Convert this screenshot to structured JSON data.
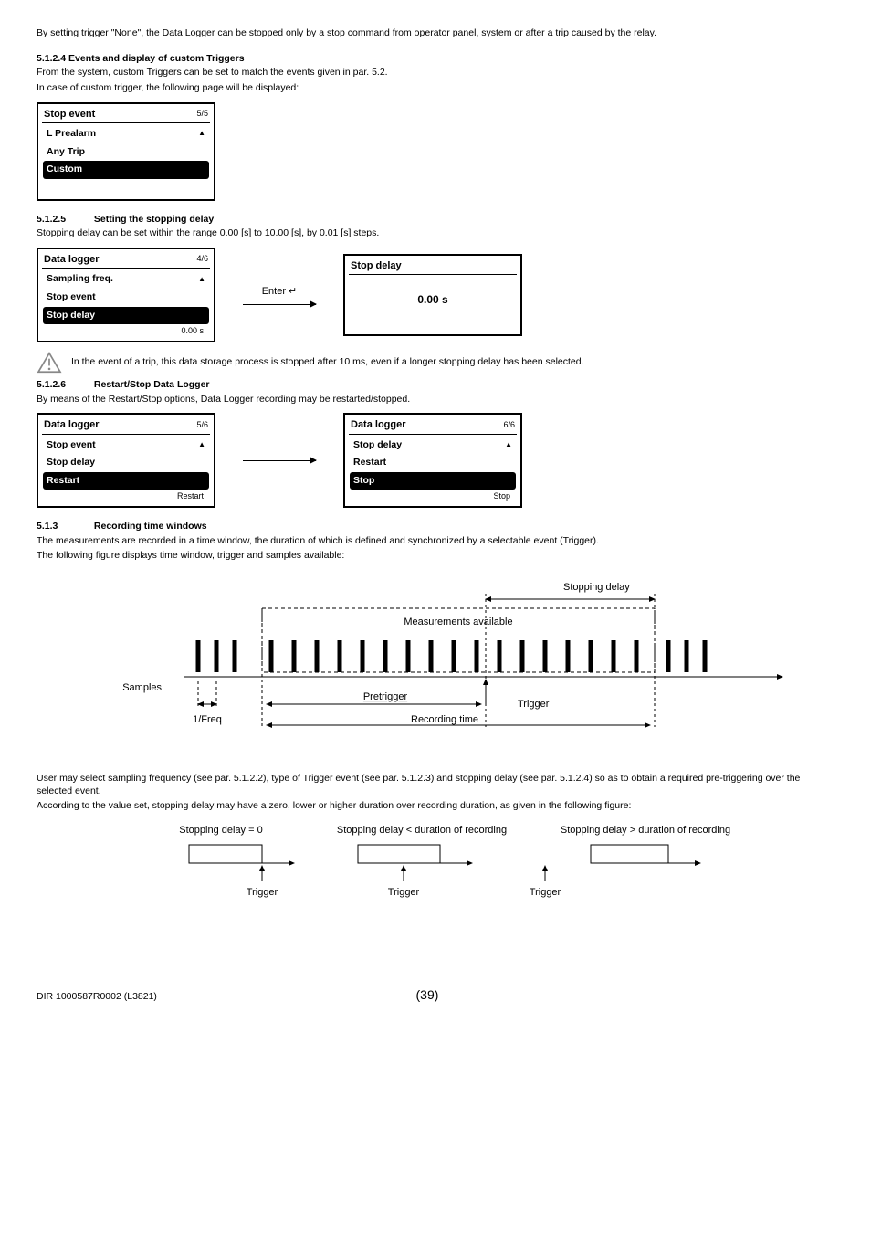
{
  "intro_para": "By setting trigger \"None\", the Data Logger can be stopped only by a stop command from operator panel, system or after a trip caused by the relay.",
  "sec_5124": {
    "heading": "5.1.2.4 Events and display of custom Triggers",
    "l1": "From the system, custom Triggers can be set to match the events given in par. 5.2.",
    "l2": "In case of custom trigger, the following page will be displayed:"
  },
  "panel_stopevent": {
    "title": "Stop event",
    "page": "5/5",
    "items": [
      "L Prealarm",
      "Any Trip",
      "Custom"
    ],
    "selected": "Custom"
  },
  "sec_5125": {
    "num": "5.1.2.5",
    "title": "Setting the stopping delay",
    "l1": "Stopping delay can be set within the range 0.00 [s] to 10.00 [s], by 0.01 [s] steps."
  },
  "panel_datalogger_46": {
    "title": "Data logger",
    "page": "4/6",
    "items": [
      "Sampling freq.",
      "Stop event",
      "Stop delay"
    ],
    "selected": "Stop delay",
    "footer": "0.00 s"
  },
  "enter_label": "Enter ↵",
  "panel_stopdelay_value": {
    "title": "Stop delay",
    "value": "0.00 s"
  },
  "warn_text": "In the event of a trip, this data storage process is stopped after 10 ms, even if a longer stopping delay has been selected.",
  "sec_5126": {
    "num": "5.1.2.6",
    "title": "Restart/Stop Data Logger",
    "l1": "By means of the Restart/Stop options, Data Logger recording may be restarted/stopped."
  },
  "panel_datalogger_56": {
    "title": "Data logger",
    "page": "5/6",
    "items": [
      "Stop event",
      "Stop delay",
      "Restart"
    ],
    "selected": "Restart",
    "footer": "Restart"
  },
  "panel_datalogger_66": {
    "title": "Data logger",
    "page": "6/6",
    "items": [
      "Stop delay",
      "Restart",
      "Stop"
    ],
    "selected": "Stop",
    "footer": "Stop"
  },
  "sec_513": {
    "num": "5.1.3",
    "title": "Recording time windows",
    "l1": "The measurements are recorded in a time window, the duration of which is defined and synchronized by a selectable event (Trigger).",
    "l2": "The following figure displays time window, trigger and samples available:"
  },
  "fig1_labels": {
    "stopping_delay": "Stopping delay",
    "measurements": "Measurements available",
    "samples": "Samples",
    "pretrigger": "Pretrigger",
    "trigger": "Trigger",
    "one_over_freq": "1/Freq",
    "recording_time": "Recording time"
  },
  "after_fig1": {
    "l1": "User may select sampling frequency (see par. 5.1.2.2), type of Trigger event (see par. 5.1.2.3) and stopping delay (see par. 5.1.2.4) so as to obtain a required pre-triggering over the selected event.",
    "l2": "According to the value set, stopping delay may have a zero, lower or higher duration over recording duration, as given in the following figure:"
  },
  "fig2_labels": {
    "c1": "Stopping delay = 0",
    "c2": "Stopping delay < duration of recording",
    "c3": "Stopping delay > duration of recording",
    "trigger": "Trigger"
  },
  "footer": {
    "doc": "DIR 1000587R0002 (L3821)",
    "page": "(39)"
  }
}
